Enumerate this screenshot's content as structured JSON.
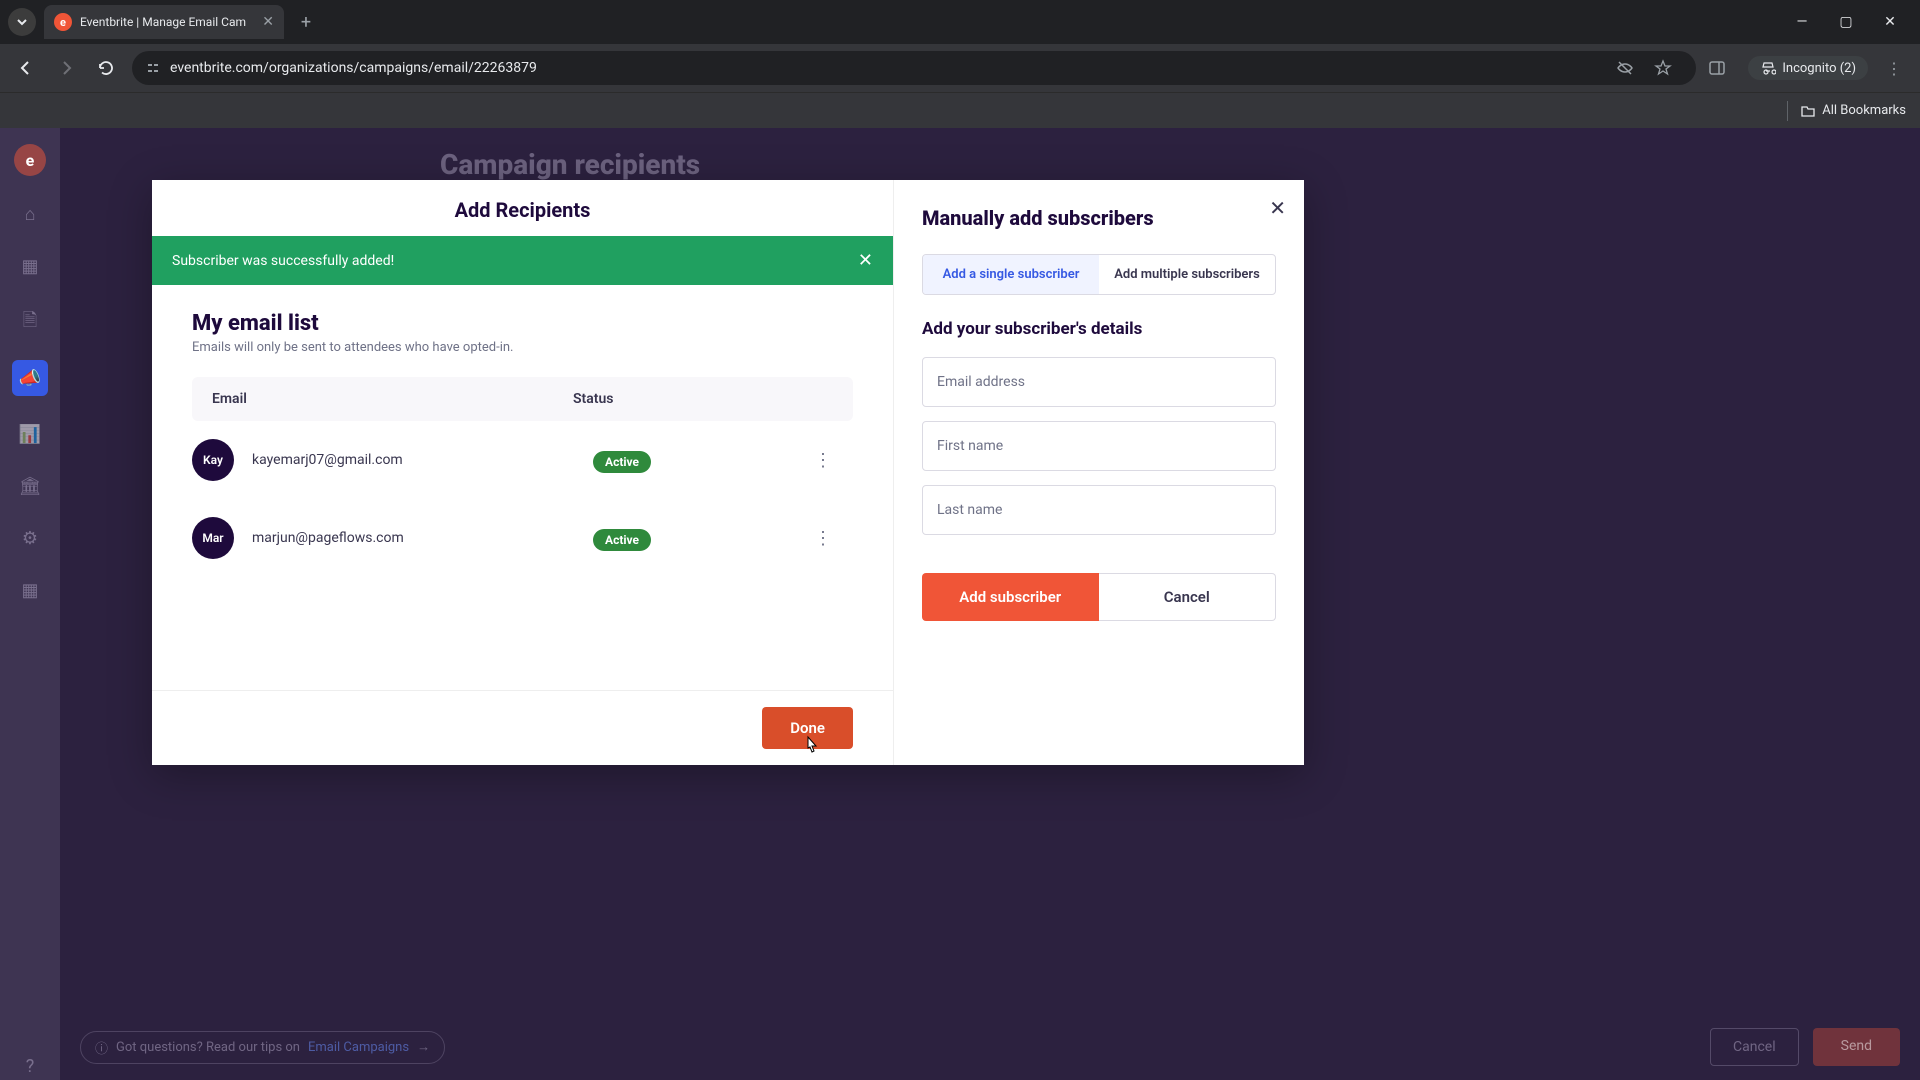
{
  "browser": {
    "tab_title": "Eventbrite | Manage Email Cam",
    "url": "eventbrite.com/organizations/campaigns/email/22263879",
    "incognito_label": "Incognito (2)",
    "bookmarks_label": "All Bookmarks"
  },
  "background": {
    "page_title": "Campaign recipients",
    "tip_prefix": "Got questions? Read our tips on ",
    "tip_link": "Email Campaigns",
    "cancel": "Cancel",
    "send": "Send"
  },
  "modal": {
    "title": "Add Recipients",
    "alert": "Subscriber was successfully added!",
    "list_title": "My email list",
    "list_subtitle": "Emails will only be sent to attendees who have opted-in.",
    "col_email": "Email",
    "col_status": "Status",
    "rows": [
      {
        "avatar": "Kay",
        "email": "kayemarj07@gmail.com",
        "status": "Active"
      },
      {
        "avatar": "Mar",
        "email": "marjun@pageflows.com",
        "status": "Active"
      }
    ],
    "done": "Done",
    "right_title": "Manually add subscribers",
    "tab_single": "Add a single subscriber",
    "tab_multiple": "Add multiple subscribers",
    "details_heading": "Add your subscriber's details",
    "ph_email": "Email address",
    "ph_first": "First name",
    "ph_last": "Last name",
    "add_btn": "Add subscriber",
    "cancel_btn": "Cancel"
  }
}
